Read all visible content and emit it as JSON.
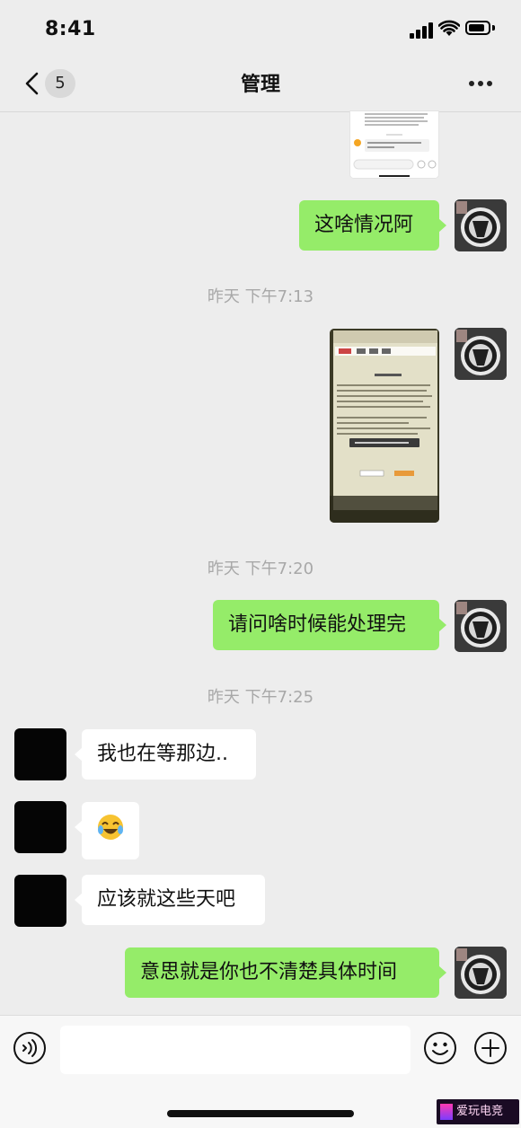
{
  "status_bar": {
    "time": "8:41"
  },
  "nav": {
    "unread_count": "5",
    "title": "管理"
  },
  "messages": [
    {
      "side": "right",
      "type": "image",
      "desc": "shared-screenshot-top"
    },
    {
      "side": "right",
      "type": "text",
      "text": "这啥情况阿"
    },
    {
      "type": "timestamp",
      "text": "昨天 下午7:13"
    },
    {
      "side": "right",
      "type": "image",
      "desc": "photo-of-monitor"
    },
    {
      "type": "timestamp",
      "text": "昨天 下午7:20"
    },
    {
      "side": "right",
      "type": "text",
      "text": "请问啥时候能处理完"
    },
    {
      "type": "timestamp",
      "text": "昨天 下午7:25"
    },
    {
      "side": "left",
      "type": "text",
      "text": "我也在等那边.."
    },
    {
      "side": "left",
      "type": "emoji",
      "emoji": "😂"
    },
    {
      "side": "left",
      "type": "text",
      "text": "应该就这些天吧"
    },
    {
      "side": "right",
      "type": "text",
      "text": "意思就是你也不清楚具体时间"
    }
  ],
  "input": {
    "value": "",
    "placeholder": ""
  },
  "watermark": {
    "text": "爱玩电竞"
  },
  "colors": {
    "bubble_self": "#95ec69",
    "bubble_other": "#ffffff",
    "background": "#ededed",
    "timestamp": "#a8a8a8"
  },
  "icons": [
    "back-chevron-icon",
    "more-icon",
    "voice-icon",
    "emoji-icon",
    "plus-icon",
    "signal-icon",
    "wifi-icon",
    "battery-icon"
  ]
}
